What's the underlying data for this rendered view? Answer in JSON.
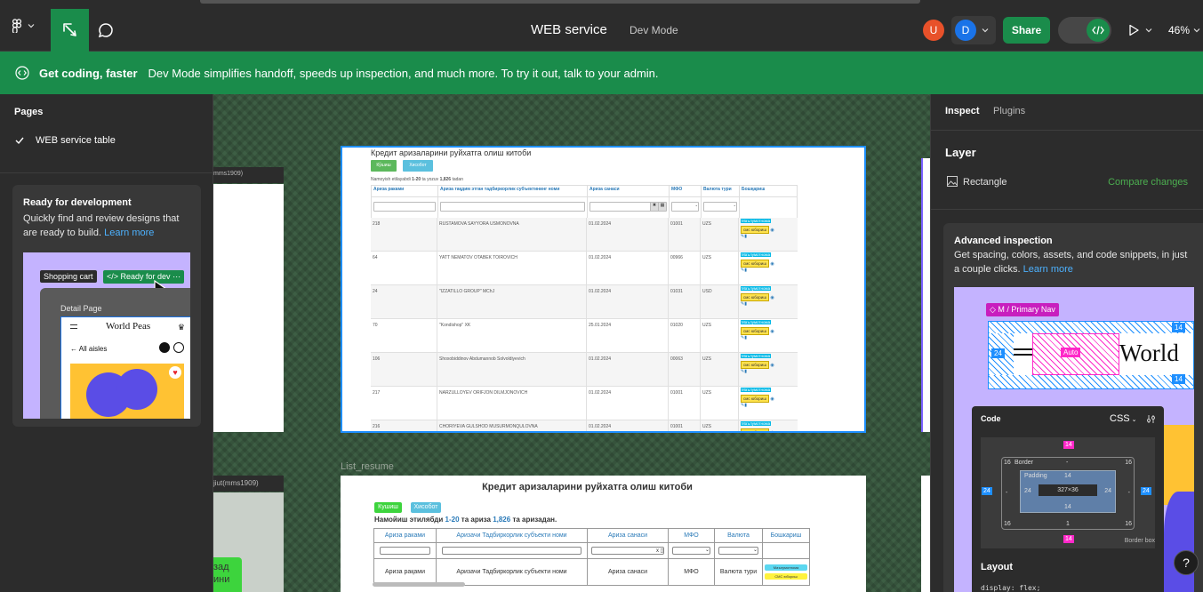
{
  "topbar": {
    "file_name": "WEB service",
    "mode_label": "Dev Mode",
    "avatars": [
      {
        "letter": "U",
        "color": "#e8512a"
      },
      {
        "letter": "D",
        "color": "#1a73e8"
      }
    ],
    "share_label": "Share",
    "zoom_label": "46%"
  },
  "banner": {
    "title": "Get coding, faster",
    "text": "Dev Mode simplifies handoff, speeds up inspection, and much more. To try it out, talk to your admin."
  },
  "left_panel": {
    "pages_heading": "Pages",
    "pages": [
      {
        "label": "WEB service table",
        "selected": true
      }
    ],
    "promo": {
      "title": "Ready for development",
      "body": "Quickly find and review designs that are ready to build.",
      "link": "Learn more",
      "preview": {
        "shopping_cart": "Shopping cart",
        "ready_badge": "Ready for dev",
        "detail_page": "Detail Page",
        "brand": "World Peas",
        "back_link": "All aisles"
      }
    }
  },
  "canvas": {
    "frame_labels": {
      "left_top": "mms1909)",
      "left_bottom": "jiut(mms1909)",
      "list_resume": "List_resume",
      "green_btn": "зад\nини"
    },
    "frame1": {
      "title": "Кредит аризаларини руйхатга олиш китоби",
      "btn_add": "Кўшиш",
      "btn_report": "Хисобот",
      "subtitle_a": "Namoyish etilayabdi",
      "subtitle_range": "1-20",
      "subtitle_b": "ta yozuv",
      "subtitle_total": "1,826",
      "subtitle_c": "tadan",
      "headers": [
        "Ариза раками",
        "Ариза тақдим этган тадбиркорлик субъектининг номи",
        "Ариза санаси",
        "МФО",
        "Валюта тури",
        "Бошқариш"
      ],
      "rows": [
        {
          "id": "218",
          "name": "RUSTAMOVA SAYYORA USMONOVNA",
          "date": "01.02.2024",
          "mfo": "01001",
          "cur": "UZS"
        },
        {
          "id": "64",
          "name": "YATT NEMATOV OTABEK TOIROVICH",
          "date": "01.02.2024",
          "mfo": "00966",
          "cur": "UZS"
        },
        {
          "id": "24",
          "name": "\"IZZATILLO GROUP\" MChJ",
          "date": "01.02.2024",
          "mfo": "01031",
          "cur": "USD"
        },
        {
          "id": "70",
          "name": "\"Kondishop\" XK",
          "date": "25.01.2024",
          "mfo": "01020",
          "cur": "UZS"
        },
        {
          "id": "106",
          "name": "Shoxobiddinov Abdumannob Solvoldiyevich",
          "date": "01.02.2024",
          "mfo": "00063",
          "cur": "UZS"
        },
        {
          "id": "217",
          "name": "NARZULLOYEV ORIFJON DILMJONOVICH",
          "date": "01.02.2024",
          "mfo": "01001",
          "cur": "UZS"
        },
        {
          "id": "216",
          "name": "CHORIYEVA GULSHOD MUSURMONQULOVNA",
          "date": "01.02.2024",
          "mfo": "01001",
          "cur": "UZS"
        }
      ],
      "status_label": "Маълумотнома",
      "sms_label": "смс юбориш"
    },
    "frame2": {
      "title": "Кредит аризаларини руйхатга олиш китоби",
      "btn_add": "Кушиш",
      "btn_report": "Хисобот",
      "subtitle_a": "Намойиш этилябди",
      "subtitle_range": "1-20",
      "subtitle_b": "та ариза",
      "subtitle_total": "1,826",
      "subtitle_c": "та аризадан.",
      "headers": [
        "Ариза раками",
        "Аризачи Тадбиркорлик субъекти номи",
        "Ариза санаси",
        "МФО",
        "Валюта",
        "Бошкариш"
      ],
      "row": [
        "Ариза рақами",
        "Аризачи Тадбиркорлик субъекти номи",
        "Ариза санаси",
        "МФО",
        "Валюта тури"
      ],
      "badge1": "Маълумотнома",
      "badge2": "СМС юбориш"
    }
  },
  "right_panel": {
    "tabs": [
      "Inspect",
      "Plugins"
    ],
    "layer_heading": "Layer",
    "layer_name": "Rectangle",
    "compare_link": "Compare changes",
    "advanced": {
      "title": "Advanced inspection",
      "body": "Get spacing, colors, assets, and code snippets, in just a couple clicks.",
      "link": "Learn more",
      "nav_tag": "M / Primary Nav",
      "auto": "Auto",
      "world": "World",
      "code_title": "Code",
      "css_label": "CSS",
      "border": "Border",
      "padding": "Padding",
      "dims": "327×36",
      "border_box": "Border box",
      "layout_heading": "Layout",
      "code_line": "display: flex;",
      "numbers": {
        "n14": "14",
        "n24": "24",
        "n16": "16",
        "n1": "1",
        "dash": "-"
      }
    }
  },
  "help_label": "?"
}
